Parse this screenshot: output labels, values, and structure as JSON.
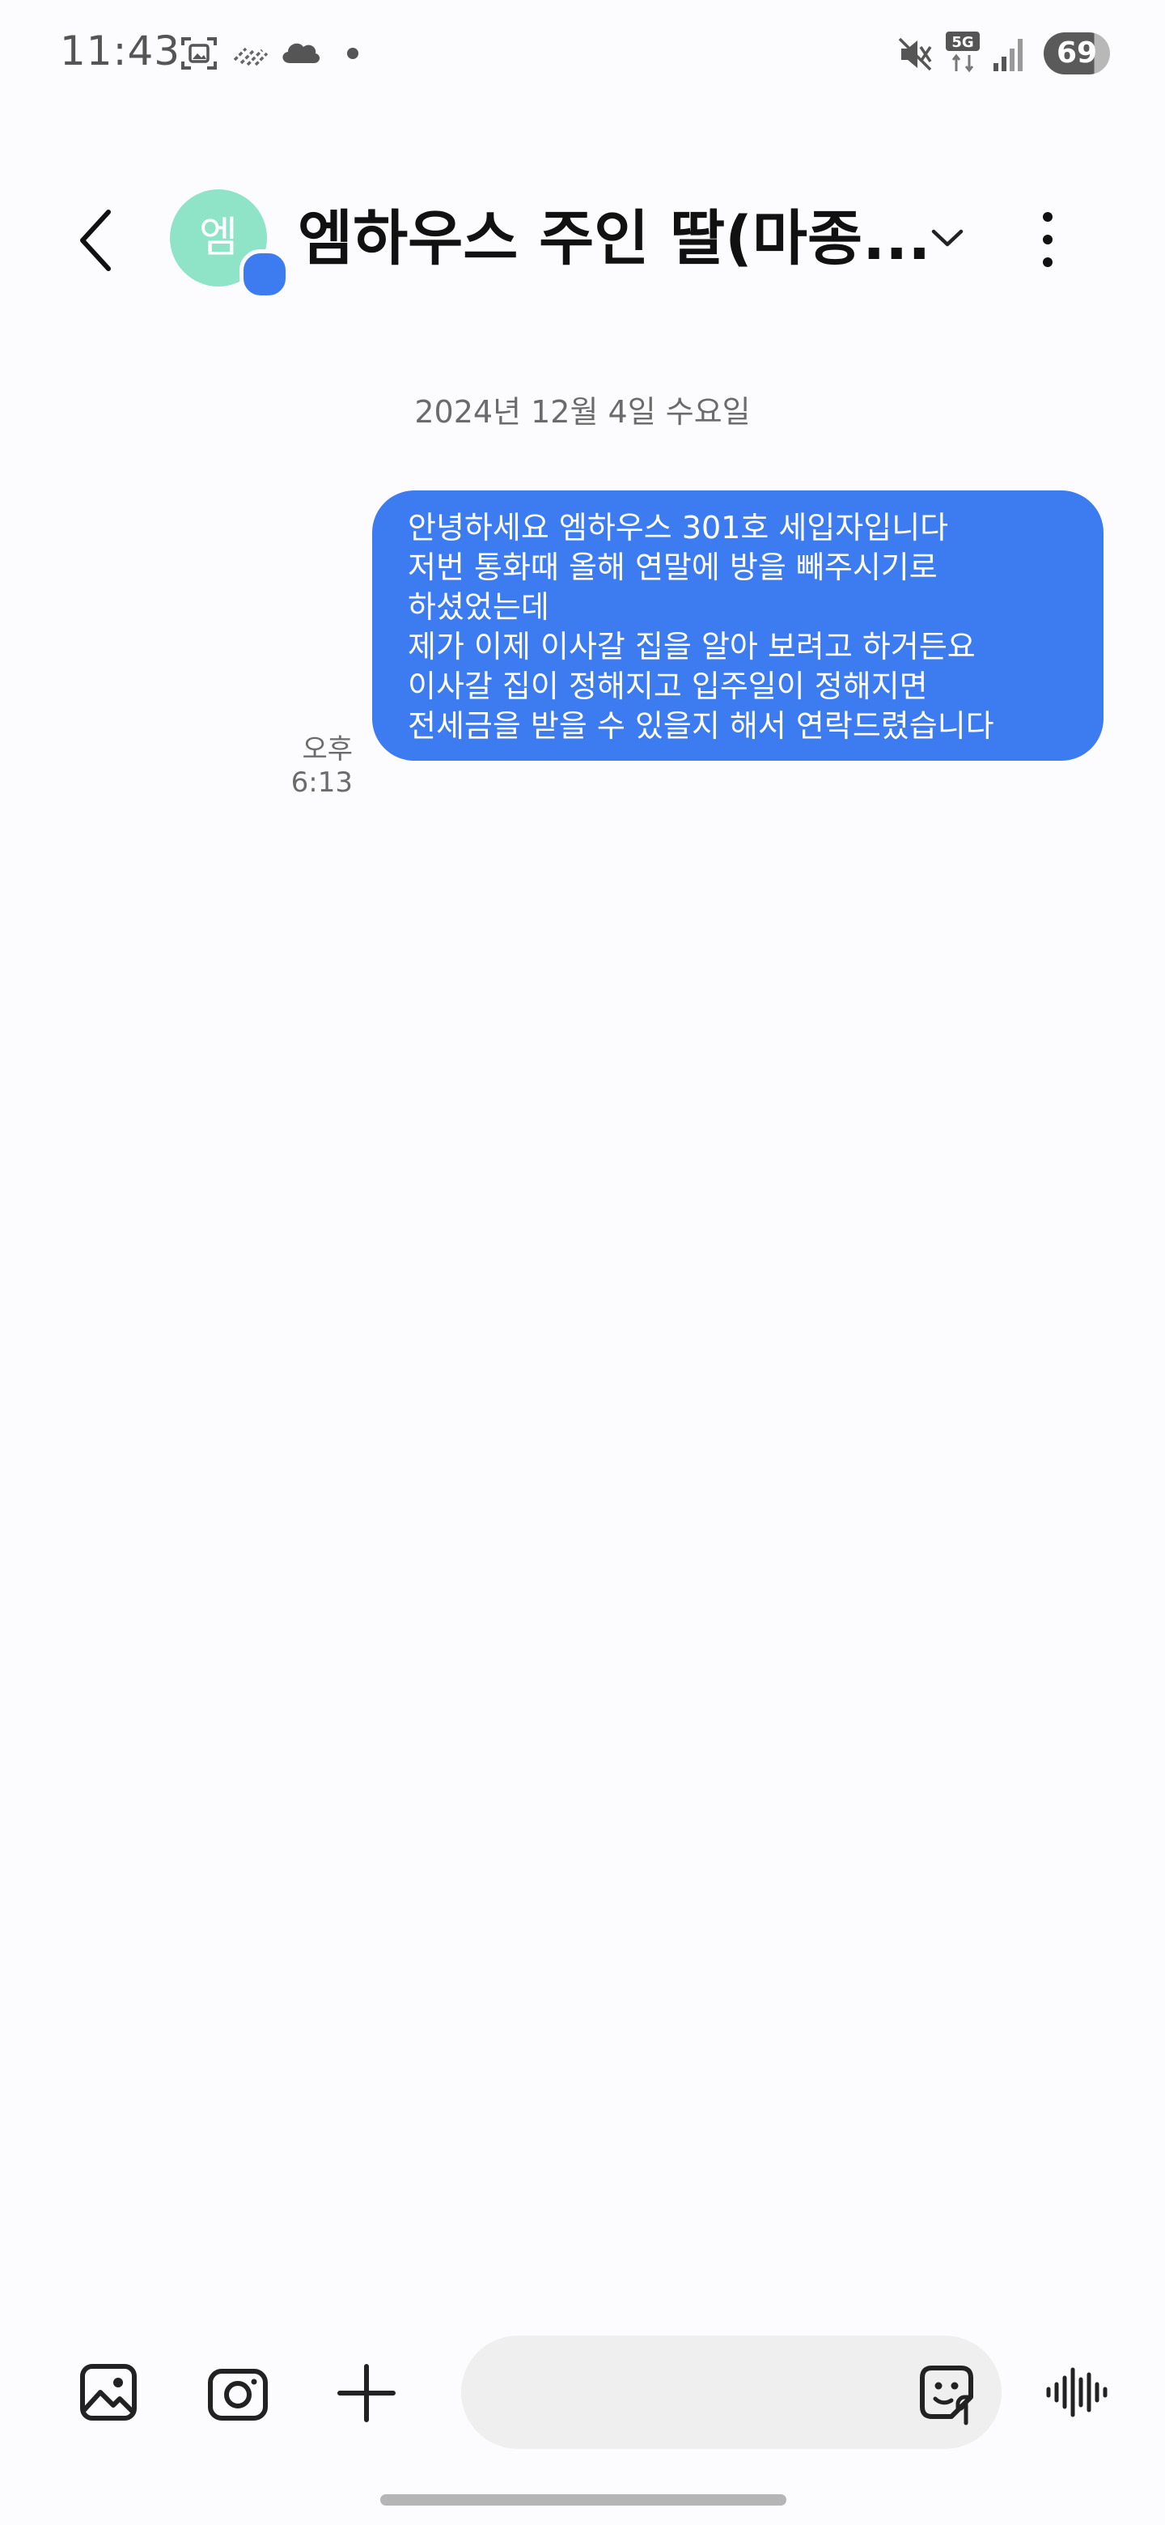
{
  "status_bar": {
    "time": "11:43",
    "network": "5G",
    "battery": "69",
    "icons": [
      "screenshot-icon",
      "no-signal-wifi-icon",
      "cloud-icon",
      "notification-dot-icon",
      "mute-icon",
      "5g-icon",
      "signal-icon",
      "battery-icon"
    ]
  },
  "header": {
    "avatar_initial": "엠",
    "contact_name": "엠하우스 주인 딸(마종...",
    "icons": [
      "back-arrow-icon",
      "chevron-down-icon",
      "more-vertical-icon"
    ]
  },
  "conversation": {
    "date_divider": "2024년 12월 4일 수요일",
    "messages": [
      {
        "direction": "outgoing",
        "time": "오후 6:13",
        "lines": [
          "안녕하세요 엠하우스 301호 세입자입니다",
          "저번 통화때 올해 연말에 방을 빼주시기로",
          "하셨었는데",
          "제가 이제 이사갈 집을 알아 보려고 하거든요",
          "이사갈 집이 정해지고 입주일이 정해지면",
          "전세금을 받을 수 있을지 해서 연락드렸습니다"
        ]
      }
    ]
  },
  "bottom_bar": {
    "icons": [
      "gallery-icon",
      "camera-icon",
      "plus-icon",
      "sticker-icon",
      "voice-waveform-icon"
    ],
    "input_placeholder": ""
  },
  "colors": {
    "bubble_outgoing": "#3d7cf0",
    "avatar_bg": "#8fe3c7",
    "background": "#fcfcfe"
  }
}
